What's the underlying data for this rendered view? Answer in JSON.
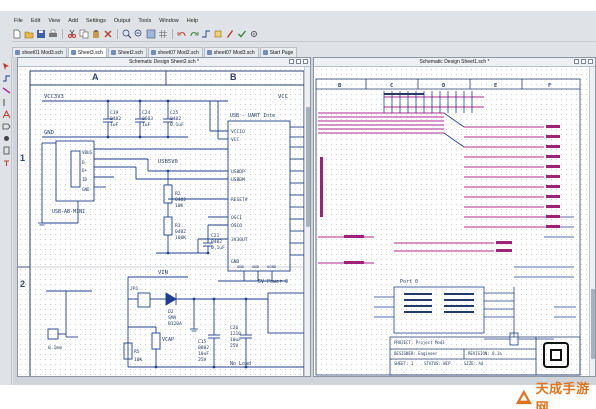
{
  "menu": [
    "File",
    "Edit",
    "View",
    "Add",
    "Settings",
    "Output",
    "Tools",
    "Window",
    "Help"
  ],
  "tabs": [
    {
      "label": "sheet01 Mod3.sch",
      "active": false
    },
    {
      "label": "Sheet3.sch",
      "active": true
    },
    {
      "label": "Sheet2.sch",
      "active": false
    },
    {
      "label": "sheet07 Mod2.sch",
      "active": false
    },
    {
      "label": "sheet07 Mod3.sch",
      "active": false
    },
    {
      "label": "Start Page",
      "active": false
    }
  ],
  "left_window": {
    "title": "Schematic Design Sheet2.sch *",
    "columns": [
      "A",
      "B"
    ],
    "rows": [
      "1",
      "2"
    ],
    "nets": {
      "vcc3v3": "VCC3V3",
      "gnd": "GND",
      "usb5v0": "USB5V0",
      "vin": "VIN",
      "vcap": "VCAP",
      "vcc": "VCC"
    },
    "usb_connector": {
      "label": "USB-AB-MINI",
      "pins": [
        "VBUS",
        "D-",
        "D+",
        "ID",
        "GND"
      ]
    },
    "uart_ic": {
      "title": "USB - UART Inte",
      "pins": [
        "VCCIO",
        "VCC",
        "USBDP",
        "USBDM",
        "RESET#",
        "OSCI",
        "OSCO",
        "3V3OUT",
        "GND"
      ],
      "bottom_pins": [
        "GND",
        "GND",
        "AGND"
      ]
    },
    "caps_top": [
      {
        "ref": "C19",
        "pkg": "0402",
        "val": "1uF"
      },
      {
        "ref": "C24",
        "pkg": "0603",
        "val": "1uF"
      },
      {
        "ref": "C25",
        "pkg": "0402",
        "val": "0.1uF"
      }
    ],
    "resistors": [
      {
        "ref": "R2",
        "pkg": "0402",
        "val": "10K"
      },
      {
        "ref": "R3",
        "pkg": "0402",
        "val": "100K"
      }
    ],
    "cap_mid": {
      "ref": "C21",
      "pkg": "0402",
      "val": "0.1uF"
    },
    "jumper": "JP1",
    "diode": {
      "ref": "D2",
      "part": "SMA",
      "num": "B120A"
    },
    "cap_c15": {
      "ref": "C15",
      "pkg": "0802",
      "val": "10uF",
      "volt": "25V"
    },
    "cap_c26": {
      "ref": "C26",
      "pkg": "1210",
      "val": "10uF",
      "volt": "25V"
    },
    "r_small": "R5",
    "r_val": "10K",
    "spacing": "0.1mm",
    "power_block": "5V Power C",
    "no_load": "No Load"
  },
  "right_window": {
    "title": "Schematic Design Sheet1.sch *",
    "columns": [
      "B",
      "C",
      "D",
      "E",
      "F"
    ],
    "chip_label": "Port 0",
    "title_block": {
      "project": "PROJECT: Project Mod3",
      "designer": "DESIGNER: Engineer",
      "revision": "REVISION: 0.1a",
      "sheet": "SHEET: 1",
      "status": "STATUS: WIP",
      "size": "SIZE: A4"
    }
  },
  "watermark": "天成手游网",
  "colors": {
    "wire": "#1f3f8f",
    "bus": "#b02a8c",
    "grid": "#c9ced6",
    "accent": "#e0731b"
  }
}
